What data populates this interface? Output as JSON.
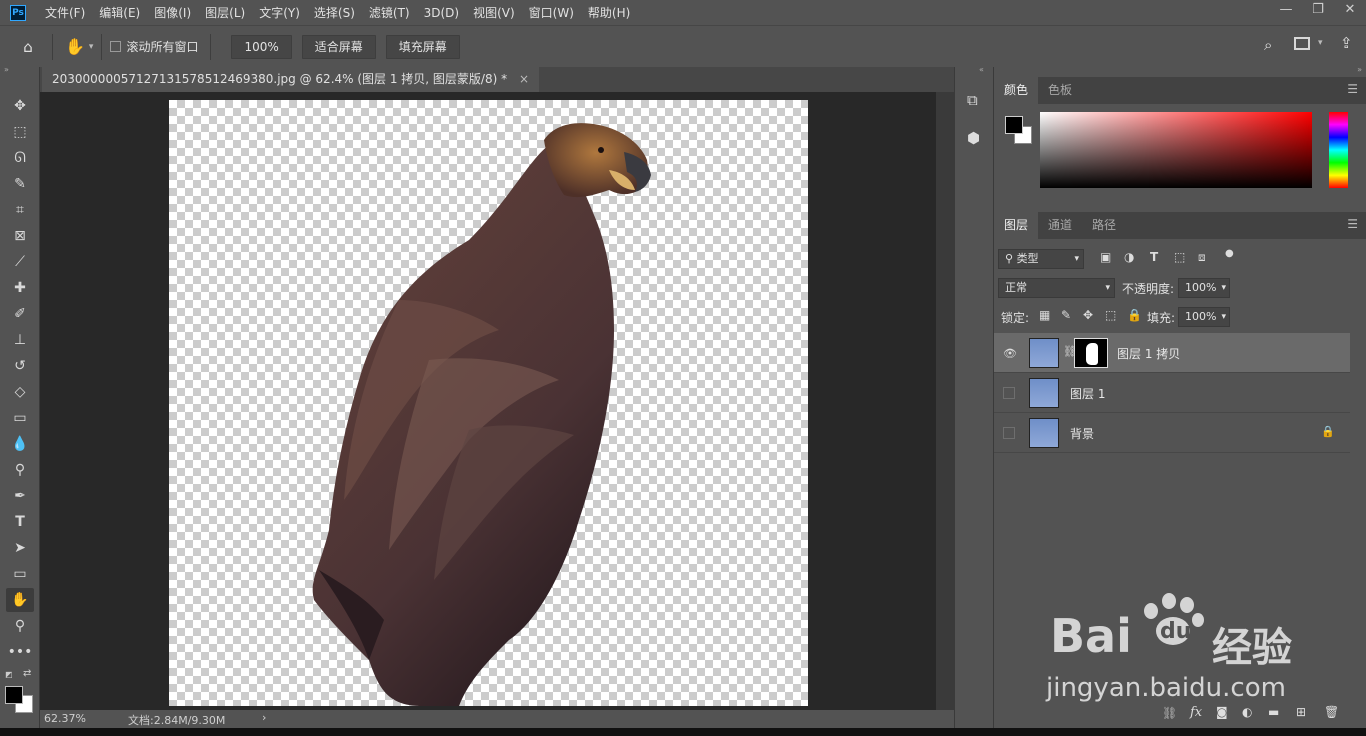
{
  "app": {
    "logo": "Ps"
  },
  "menu": [
    "文件(F)",
    "编辑(E)",
    "图像(I)",
    "图层(L)",
    "文字(Y)",
    "选择(S)",
    "滤镜(T)",
    "3D(D)",
    "视图(V)",
    "窗口(W)",
    "帮助(H)"
  ],
  "window_controls": {
    "minimize": "—",
    "restore": "❐",
    "close": "✕"
  },
  "options": {
    "scroll_all_label": "滚动所有窗口",
    "zoom_value": "100%",
    "fit_screen": "适合屏幕",
    "fill_screen": "填充屏幕"
  },
  "document": {
    "tab_title": "20300000057127131578512469380.jpg @ 62.4% (图层 1 拷贝, 图层蒙版/8) *",
    "tab_close": "×"
  },
  "status": {
    "zoom": "62.37%",
    "doc_info": "文档:2.84M/9.30M",
    "arrow": "›"
  },
  "color_panel": {
    "tabs": [
      "颜色",
      "色板"
    ]
  },
  "layers_panel": {
    "tabs": [
      "图层",
      "通道",
      "路径"
    ],
    "filter_label": "类型",
    "blend_mode": "正常",
    "opacity_label": "不透明度:",
    "opacity_value": "100%",
    "lock_label": "锁定:",
    "fill_label": "填充:",
    "fill_value": "100%",
    "layers": [
      {
        "name": "图层 1 拷贝",
        "visible": true,
        "selected": true,
        "has_mask": true
      },
      {
        "name": "图层 1",
        "visible": false,
        "selected": false,
        "has_mask": false
      },
      {
        "name": "背景",
        "visible": false,
        "selected": false,
        "locked": true
      }
    ],
    "fx_label": "fx"
  },
  "watermark": {
    "brand": "Bai",
    "brand_du": "du",
    "cn": "经验",
    "url": "jingyan.baidu.com"
  },
  "colors": {
    "panel_bg": "#535353",
    "canvas_bg": "#282828",
    "accent": "#31a8ff"
  }
}
